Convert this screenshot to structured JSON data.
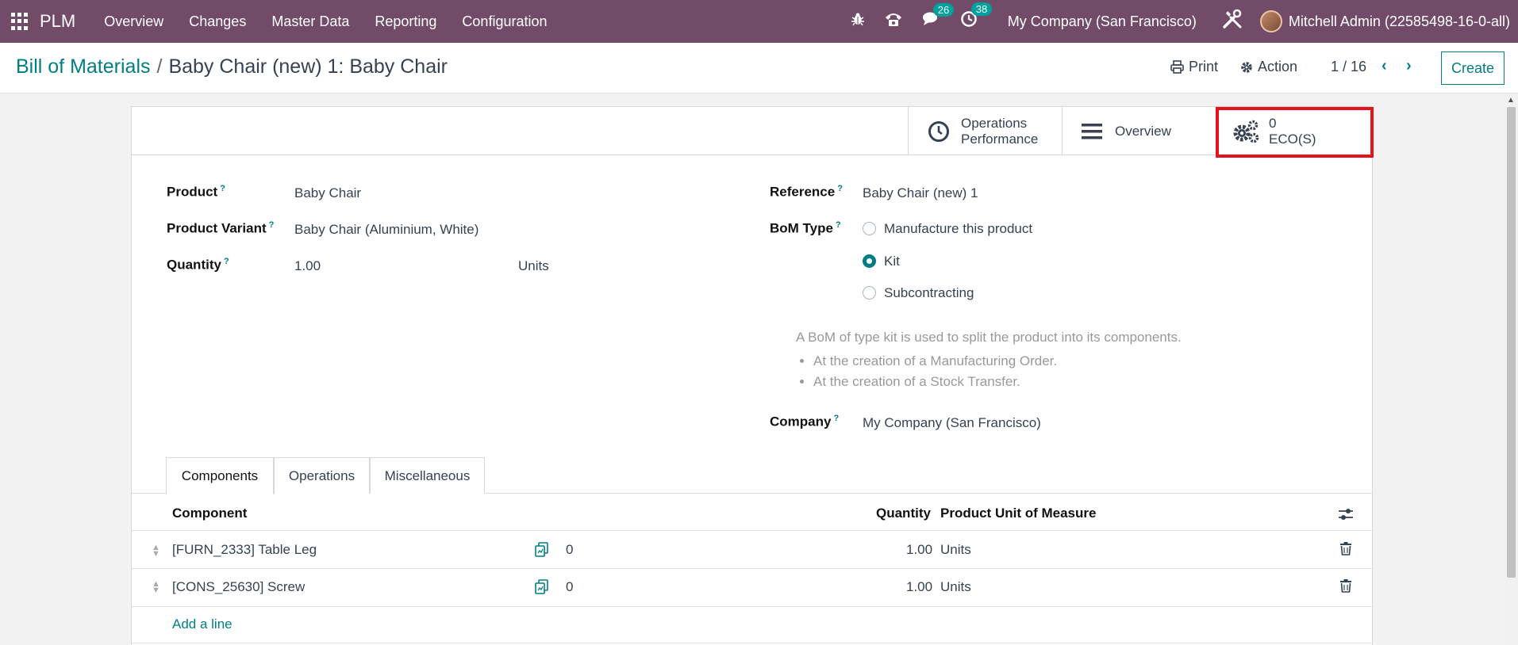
{
  "navbar": {
    "brand": "PLM",
    "menu": [
      "Overview",
      "Changes",
      "Master Data",
      "Reporting",
      "Configuration"
    ],
    "messages_count": "26",
    "activities_count": "38",
    "company": "My Company (San Francisco)",
    "user": "Mitchell Admin (22585498-16-0-all)"
  },
  "control": {
    "breadcrumb_parent": "Bill of Materials",
    "breadcrumb_separator": "/",
    "breadcrumb_current": "Baby Chair (new) 1: Baby Chair",
    "print_label": "Print",
    "action_label": "Action",
    "pager": "1 / 16",
    "create_label": "Create"
  },
  "smart_buttons": {
    "operations_line1": "Operations",
    "operations_line2": "Performance",
    "overview": "Overview",
    "eco_count": "0",
    "eco_label": "ECO(S)"
  },
  "form": {
    "product_label": "Product",
    "product_value": "Baby Chair",
    "variant_label": "Product Variant",
    "variant_value": "Baby Chair (Aluminium, White)",
    "quantity_label": "Quantity",
    "quantity_value": "1.00",
    "quantity_uom": "Units",
    "reference_label": "Reference",
    "reference_value": "Baby Chair (new) 1",
    "bom_type_label": "BoM Type",
    "bom_type_options": [
      "Manufacture this product",
      "Kit",
      "Subcontracting"
    ],
    "bom_type_selected": "Kit",
    "kit_note": "A BoM of type kit is used to split the product into its components.",
    "kit_note_items": [
      "At the creation of a Manufacturing Order.",
      "At the creation of a Stock Transfer."
    ],
    "company_label": "Company",
    "company_value": "My Company (San Francisco)",
    "help_mark": "?"
  },
  "tabs": [
    "Components",
    "Operations",
    "Miscellaneous"
  ],
  "table": {
    "headers": {
      "component": "Component",
      "quantity": "Quantity",
      "uom": "Product Unit of Measure"
    },
    "rows": [
      {
        "component": "[FURN_2333] Table Leg",
        "available": "0",
        "quantity": "1.00",
        "uom": "Units"
      },
      {
        "component": "[CONS_25630] Screw",
        "available": "0",
        "quantity": "1.00",
        "uom": "Units"
      }
    ],
    "add_line": "Add a line"
  },
  "colors": {
    "navbar": "#714b67",
    "accent": "#017e84",
    "highlight": "#e3121d",
    "badge": "#00a09d"
  }
}
